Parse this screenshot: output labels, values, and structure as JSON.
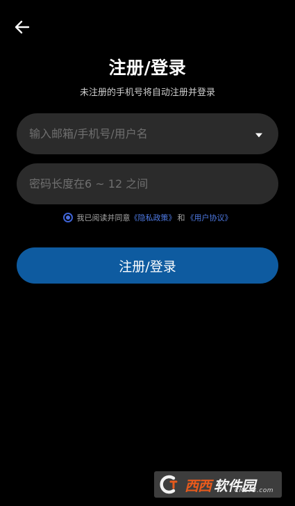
{
  "header": {
    "back_icon": "arrow-left-icon",
    "title": "注册/登录",
    "subtitle": "未注册的手机号将自动注册并登录"
  },
  "form": {
    "account_placeholder": "输入邮箱/手机号/用户名",
    "account_value": "",
    "dropdown_icon": "caret-down-icon",
    "password_placeholder": "密码长度在6 ~ 12 之间",
    "password_value": ""
  },
  "agreement": {
    "checked": true,
    "prefix": "我已阅读并同意",
    "privacy_link": "《隐私政策》",
    "and": "和",
    "terms_link": "《用户协议》",
    "link_color": "#4f7be6"
  },
  "submit": {
    "label": "注册/登录",
    "color": "#0e5ba0"
  },
  "watermark": {
    "brand_xi": "西西",
    "brand_site": "软件园",
    "domain": "CR173.com"
  },
  "colors": {
    "background": "#000000",
    "field_background": "#2b2b2b",
    "radio_accent": "#3e63d6"
  }
}
